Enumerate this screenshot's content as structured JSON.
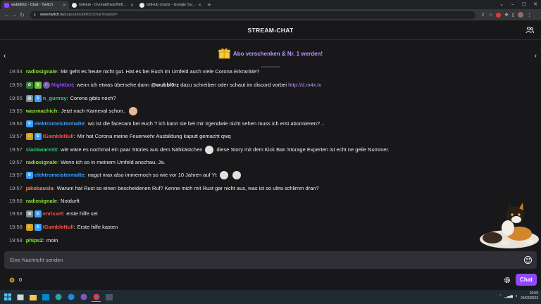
{
  "browser": {
    "tabs": [
      {
        "label": "wubbl0rz - Chat - Twitch",
        "color": "#9147ff",
        "active": true
      },
      {
        "label": "GitHub - DvorakDwarf/Infinite-Storage-Glitch",
        "color": "#ffffff",
        "active": false
      },
      {
        "label": "GitHub charts - Google Suche",
        "color": "#ffffff",
        "active": false
      }
    ],
    "url_host": "www.twitch.tv",
    "url_path": "/popout/wubbl0rz/chat?popout="
  },
  "header": {
    "title": "STREAM-CHAT"
  },
  "banner": {
    "text": "Abo verschenken & Nr. 1 werden!"
  },
  "messages": [
    {
      "time": "19:54",
      "badges": [],
      "user": "radiosignale",
      "color": "#8ae234",
      "text": "Mir geht es heute nicht gut. Hat es bei Euch im Umfeld auch viele Corona Erkrankte?",
      "partial": true
    },
    {
      "time": "19:55",
      "badges": [
        "green",
        "lime",
        "purple"
      ],
      "user": "Nightbot",
      "color": "#9147ff",
      "text": "wenn ich etwas übersehe dann",
      "mention": "@wubbl0rz",
      "text2": "dazu schreiben oder schaut im discord vorbei",
      "link": "http://d.m4x.tv"
    },
    {
      "time": "19:55",
      "badges": [
        "gray",
        "crown"
      ],
      "user": "n_gunray",
      "color": "#2ecc71",
      "text": "Corona gibts noch?"
    },
    {
      "time": "19:55",
      "badges": [],
      "user": "wasmachich",
      "color": "#8ae234",
      "text": "Jetzt nach Karneval schon..",
      "emote": "skin"
    },
    {
      "time": "19:56",
      "badges": [
        "crown"
      ],
      "user": "elektromeistermalte",
      "color": "#3aa0ff",
      "text": "wo ist die facecam bei euch ? ich kann sie bei mir irgendwie nicht sehen muss ich erst abonnieren? .."
    },
    {
      "time": "19:57",
      "badges": [
        "gold",
        "crown"
      ],
      "user": "IGambleNull",
      "color": "#ff4f3f",
      "text": "Mir hat Corona meine Feuerwehr Ausbildung kaputt gemacht qwq"
    },
    {
      "time": "19:57",
      "badges": [],
      "user": "slackware33",
      "color": "#2ecc71",
      "text": "wie wäre es nochmal ein paar Stories aus dem Nähkästchen",
      "emote": "white",
      "text2": "diese Story mit dem Kick Ban Storage Experten ist echt ne geile Nummer."
    },
    {
      "time": "19:57",
      "badges": [],
      "user": "radiosignale",
      "color": "#8ae234",
      "text": "Wenn ich so in meinem Umfeld anschau. Ja."
    },
    {
      "time": "19:57",
      "badges": [
        "crown"
      ],
      "user": "elektromeistermalte",
      "color": "#3aa0ff",
      "text": "nagut max also immernoch so wie vor 10 Jahren auf Yt",
      "emote": "white",
      "emote2": "white"
    },
    {
      "time": "19:57",
      "badges": [],
      "user": "jakobausla",
      "color": "#ff7f50",
      "text": "Warum hat Rust so einen bescheidenen Ruf? Kenne mich mit Rust gar nicht aus, was ist so ultra schlimm dran?"
    },
    {
      "time": "19:58",
      "badges": [],
      "user": "radiosignale",
      "color": "#8ae234",
      "text": "Notdurft"
    },
    {
      "time": "19:58",
      "badges": [
        "gray",
        "crown"
      ],
      "user": "enrixxel",
      "color": "#ff4f3f",
      "text": "erste hilfe set"
    },
    {
      "time": "19:58",
      "badges": [
        "gold",
        "crown"
      ],
      "user": "IGambleNull",
      "color": "#ff4f3f",
      "text": "Erste hilfe kasten"
    },
    {
      "time": "19:58",
      "badges": [],
      "user": "phips2",
      "color": "#8ae234",
      "text": "moin"
    }
  ],
  "input": {
    "placeholder": "Eine Nachricht senden"
  },
  "footer": {
    "points": "0",
    "chat_button": "Chat"
  },
  "taskbar": {
    "time": "19:59",
    "date": "24/02/2023"
  }
}
